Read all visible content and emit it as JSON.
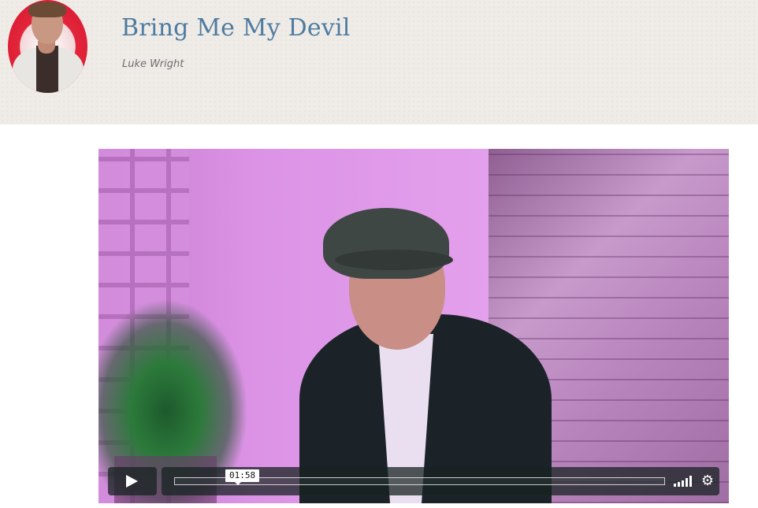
{
  "header": {
    "title": "Bring Me My Devil",
    "author": "Luke Wright"
  },
  "video": {
    "current_time": "01:58",
    "progress_fraction": 0.0
  },
  "icons": {
    "play": "play-icon",
    "volume": "volume-icon",
    "settings": "gear-icon"
  },
  "colors": {
    "title": "#4e7ba0",
    "header_bg": "#efece8",
    "controls_bg": "#172322"
  }
}
